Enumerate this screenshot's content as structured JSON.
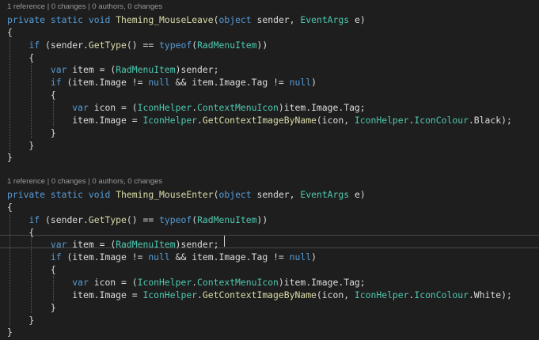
{
  "colors": {
    "background": "#1e1e1e",
    "keyword": "#569cd6",
    "type": "#4ec9b0",
    "method": "#dcdcaa",
    "plain": "#dcdcdc",
    "codelens": "#999999"
  },
  "blocks": [
    {
      "codelens": [
        "1 reference",
        "0 changes",
        "0 authors, 0 changes"
      ],
      "code": [
        [
          [
            "private",
            "kw"
          ],
          [
            " ",
            "p"
          ],
          [
            "static",
            "kw"
          ],
          [
            " ",
            "p"
          ],
          [
            "void",
            "kw"
          ],
          [
            " ",
            "p"
          ],
          [
            "Theming_MouseLeave",
            "fn"
          ],
          [
            "(",
            "p"
          ],
          [
            "object",
            "kw"
          ],
          [
            " sender, ",
            "p"
          ],
          [
            "EventArgs",
            "ty"
          ],
          [
            " e)",
            "p"
          ]
        ],
        [
          [
            "{",
            "p"
          ]
        ],
        [
          [
            "    ",
            "p"
          ],
          [
            "if",
            "kw"
          ],
          [
            " (sender.",
            "p"
          ],
          [
            "GetType",
            "fn"
          ],
          [
            "() == ",
            "p"
          ],
          [
            "typeof",
            "kw"
          ],
          [
            "(",
            "p"
          ],
          [
            "RadMenuItem",
            "ty"
          ],
          [
            "))",
            "p"
          ]
        ],
        [
          [
            "    {",
            "p"
          ]
        ],
        [
          [
            "        ",
            "p"
          ],
          [
            "var",
            "kw"
          ],
          [
            " item = (",
            "p"
          ],
          [
            "RadMenuItem",
            "ty"
          ],
          [
            ")sender;",
            "p"
          ]
        ],
        [
          [
            "        ",
            "p"
          ],
          [
            "if",
            "kw"
          ],
          [
            " (item.Image != ",
            "p"
          ],
          [
            "null",
            "kw"
          ],
          [
            " && item.Image.Tag != ",
            "p"
          ],
          [
            "null",
            "kw"
          ],
          [
            ")",
            "p"
          ]
        ],
        [
          [
            "        {",
            "p"
          ]
        ],
        [
          [
            "            ",
            "p"
          ],
          [
            "var",
            "kw"
          ],
          [
            " icon = (",
            "p"
          ],
          [
            "IconHelper",
            "ty"
          ],
          [
            ".",
            "p"
          ],
          [
            "ContextMenuIcon",
            "ty"
          ],
          [
            ")item.Image.Tag;",
            "p"
          ]
        ],
        [
          [
            "            item.Image = ",
            "p"
          ],
          [
            "IconHelper",
            "ty"
          ],
          [
            ".",
            "p"
          ],
          [
            "GetContextImageByName",
            "fn"
          ],
          [
            "(icon, ",
            "p"
          ],
          [
            "IconHelper",
            "ty"
          ],
          [
            ".",
            "p"
          ],
          [
            "IconColour",
            "ty"
          ],
          [
            ".Black);",
            "p"
          ]
        ],
        [
          [
            "        }",
            "p"
          ]
        ],
        [
          [
            "    }",
            "p"
          ]
        ],
        [
          [
            "}",
            "p"
          ]
        ]
      ]
    },
    {
      "codelens": [
        "1 reference",
        "0 changes",
        "0 authors, 0 changes"
      ],
      "code": [
        [
          [
            "private",
            "kw"
          ],
          [
            " ",
            "p"
          ],
          [
            "static",
            "kw"
          ],
          [
            " ",
            "p"
          ],
          [
            "void",
            "kw"
          ],
          [
            " ",
            "p"
          ],
          [
            "Theming_MouseEnter",
            "fn"
          ],
          [
            "(",
            "p"
          ],
          [
            "object",
            "kw"
          ],
          [
            " sender, ",
            "p"
          ],
          [
            "EventArgs",
            "ty"
          ],
          [
            " e)",
            "p"
          ]
        ],
        [
          [
            "{",
            "p"
          ]
        ],
        [
          [
            "    ",
            "p"
          ],
          [
            "if",
            "kw"
          ],
          [
            " (sender.",
            "p"
          ],
          [
            "GetType",
            "fn"
          ],
          [
            "() == ",
            "p"
          ],
          [
            "typeof",
            "kw"
          ],
          [
            "(",
            "p"
          ],
          [
            "RadMenuItem",
            "ty"
          ],
          [
            "))",
            "p"
          ]
        ],
        [
          [
            "    {",
            "p"
          ]
        ],
        [
          [
            "        ",
            "p"
          ],
          [
            "var",
            "kw"
          ],
          [
            " item = (",
            "p"
          ],
          [
            "RadMenuItem",
            "ty"
          ],
          [
            ")sender;",
            "p"
          ]
        ],
        [
          [
            "        ",
            "p"
          ],
          [
            "if",
            "kw"
          ],
          [
            " (item.Image != ",
            "p"
          ],
          [
            "null",
            "kw"
          ],
          [
            " && item.Image.Tag != ",
            "p"
          ],
          [
            "null",
            "kw"
          ],
          [
            ")",
            "p"
          ]
        ],
        [
          [
            "        {",
            "p"
          ]
        ],
        [
          [
            "            ",
            "p"
          ],
          [
            "var",
            "kw"
          ],
          [
            " icon = (",
            "p"
          ],
          [
            "IconHelper",
            "ty"
          ],
          [
            ".",
            "p"
          ],
          [
            "ContextMenuIcon",
            "ty"
          ],
          [
            ")item.Image.Tag;",
            "p"
          ]
        ],
        [
          [
            "            item.Image = ",
            "p"
          ],
          [
            "IconHelper",
            "ty"
          ],
          [
            ".",
            "p"
          ],
          [
            "GetContextImageByName",
            "fn"
          ],
          [
            "(icon, ",
            "p"
          ],
          [
            "IconHelper",
            "ty"
          ],
          [
            ".",
            "p"
          ],
          [
            "IconColour",
            "ty"
          ],
          [
            ".White);",
            "p"
          ]
        ],
        [
          [
            "        }",
            "p"
          ]
        ],
        [
          [
            "    }",
            "p"
          ]
        ],
        [
          [
            "}",
            "p"
          ]
        ]
      ]
    }
  ]
}
